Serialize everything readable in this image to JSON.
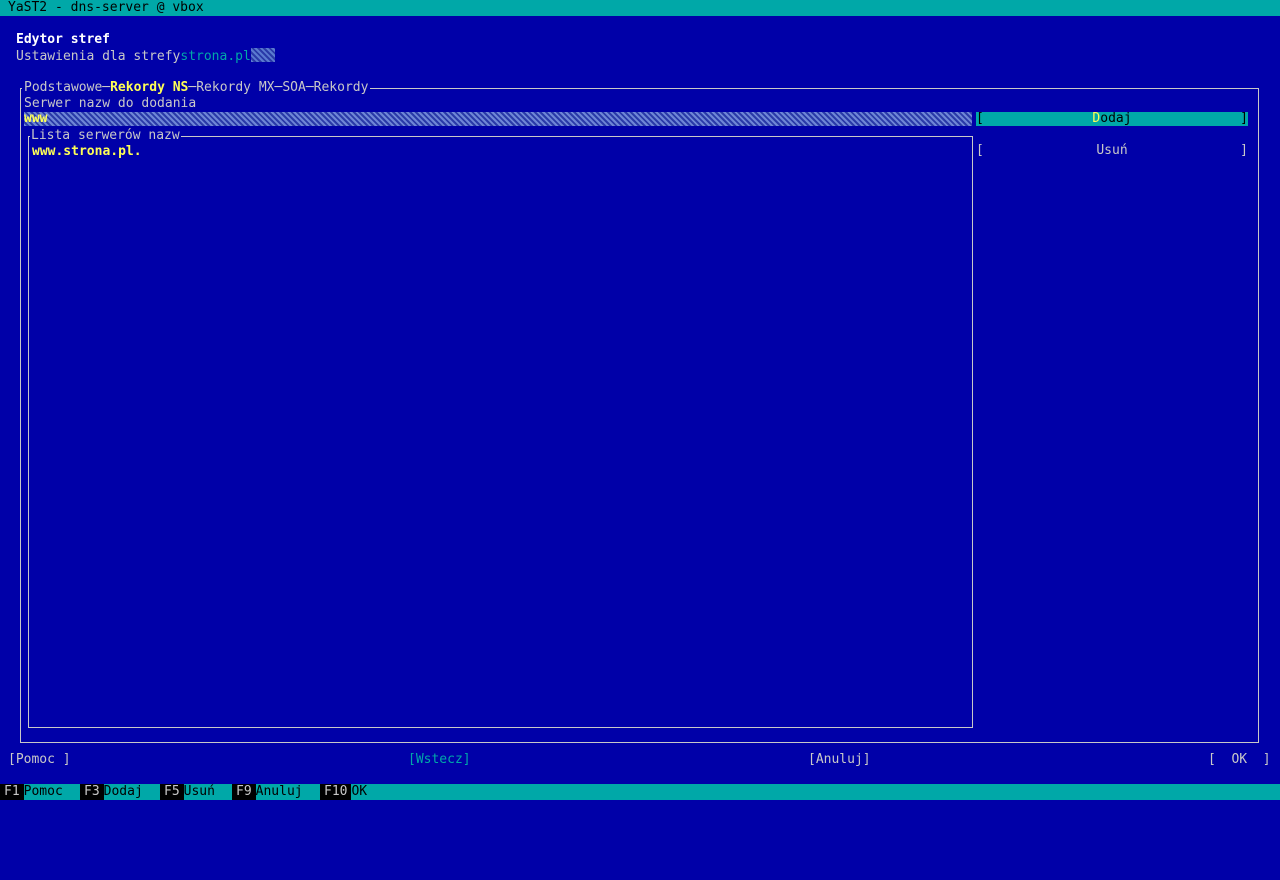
{
  "window": {
    "title": "YaST2 - dns-server @ vbox"
  },
  "header": {
    "title": "Edytor stref",
    "subtitle_prefix": "Ustawienia dla strefy",
    "zone_name": "strona.pl"
  },
  "tabs": [
    {
      "label": "Podstawowe",
      "active": false
    },
    {
      "label": "Rekordy NS",
      "active": true
    },
    {
      "label": "Rekordy MX",
      "active": false
    },
    {
      "label": "SOA",
      "active": false
    },
    {
      "label": "Rekordy",
      "active": false
    }
  ],
  "tab_separator": "─",
  "form": {
    "nameserver_label": "Serwer nazw do dodania",
    "nameserver_value": "www"
  },
  "buttons": {
    "add_left": "[",
    "add_label_hot": "D",
    "add_label_rest": "odaj",
    "add_right": "]",
    "delete_left": "[",
    "delete_label": "Usuń",
    "delete_right": "]"
  },
  "list": {
    "legend": "Lista serwerów nazw",
    "items": [
      "www.strona.pl."
    ]
  },
  "bottom": {
    "help": "[Pomoc ]",
    "back": "[Wstecz]",
    "cancel": "[Anuluj]",
    "ok": "[  OK  ]"
  },
  "fkeys": [
    {
      "key": "F1",
      "action": "Pomoc"
    },
    {
      "key": "F3",
      "action": "Dodaj"
    },
    {
      "key": "F5",
      "action": "Usuń"
    },
    {
      "key": "F9",
      "action": "Anuluj"
    },
    {
      "key": "F10",
      "action": "OK"
    }
  ],
  "colors": {
    "background": "#0000a8",
    "accent": "#00a8a8",
    "highlight": "#ffff55",
    "text": "#c8c8c8"
  }
}
